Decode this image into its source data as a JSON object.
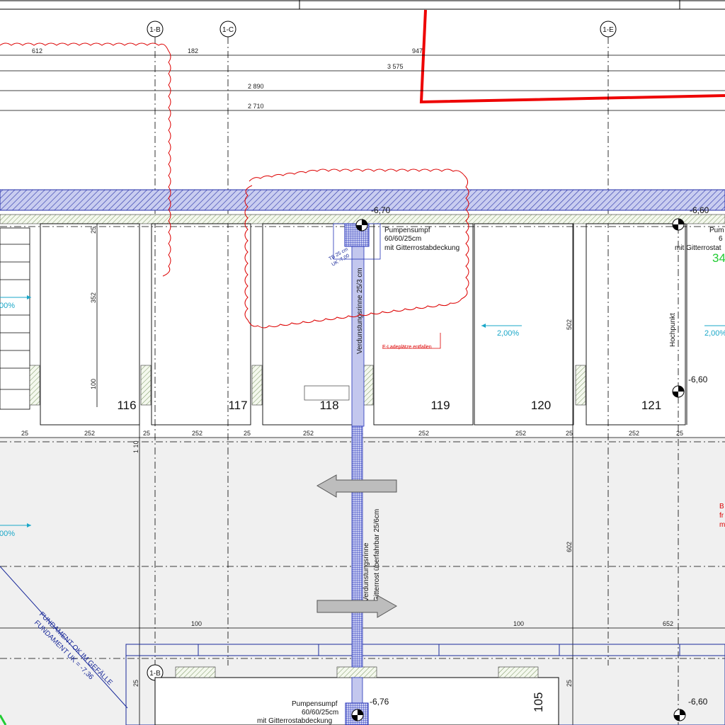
{
  "axes": {
    "b": "1-B",
    "c": "1-C",
    "e": "1-E",
    "b_lower": "1-B"
  },
  "dimensions": {
    "top": [
      "612",
      "182",
      "947",
      "3 575",
      "2 890",
      "2 710"
    ],
    "row": [
      "25",
      "252",
      "25",
      "252",
      "25",
      "252",
      "25",
      "252",
      "25",
      "252",
      "25",
      "252"
    ],
    "vertical": [
      "25",
      "352",
      "100",
      "502",
      "1 10",
      "602",
      "25",
      "25"
    ],
    "bottom": [
      "100",
      "25",
      "100",
      "652"
    ]
  },
  "rooms": [
    "116",
    "117",
    "118",
    "119",
    "120",
    "121",
    "105"
  ],
  "levels": {
    "l1": "-6,70",
    "l2": "-6,60",
    "l3": "-6,60",
    "l4": "-6,76",
    "l5": "-6,60"
  },
  "notes": {
    "sump1": [
      "Pumpensumpf",
      "60/60/25cm",
      "mit Gitterrostabdeckung"
    ],
    "sump_right": [
      "Pum",
      "6",
      "mit Gitterrostat"
    ],
    "sump2": [
      "Pumpensumpf",
      "60/60/25cm",
      "mit Gitterrostabdeckung"
    ],
    "channel1": "Verdunstungsrinne 25/3 cm",
    "channel2a": "Verdunstungsrinne",
    "channel2b": "Gitterrost überfahrbar 25/6cm",
    "hochpunkt": "Hochpunkt",
    "fund1": "FUNDAMENT OK IM GEFÄLLE",
    "fund2": "FUNDAMENT UK = -7,36",
    "red_note": "E-Ladeplätze entfallen",
    "blue_small1": "TB 25 cm",
    "blue_small2": "UK -7,00",
    "red_right": [
      "B",
      "fr",
      "m"
    ]
  },
  "slopes": [
    "2,00%",
    "2,00%",
    ",00%",
    ",00%"
  ],
  "green_label": "34"
}
